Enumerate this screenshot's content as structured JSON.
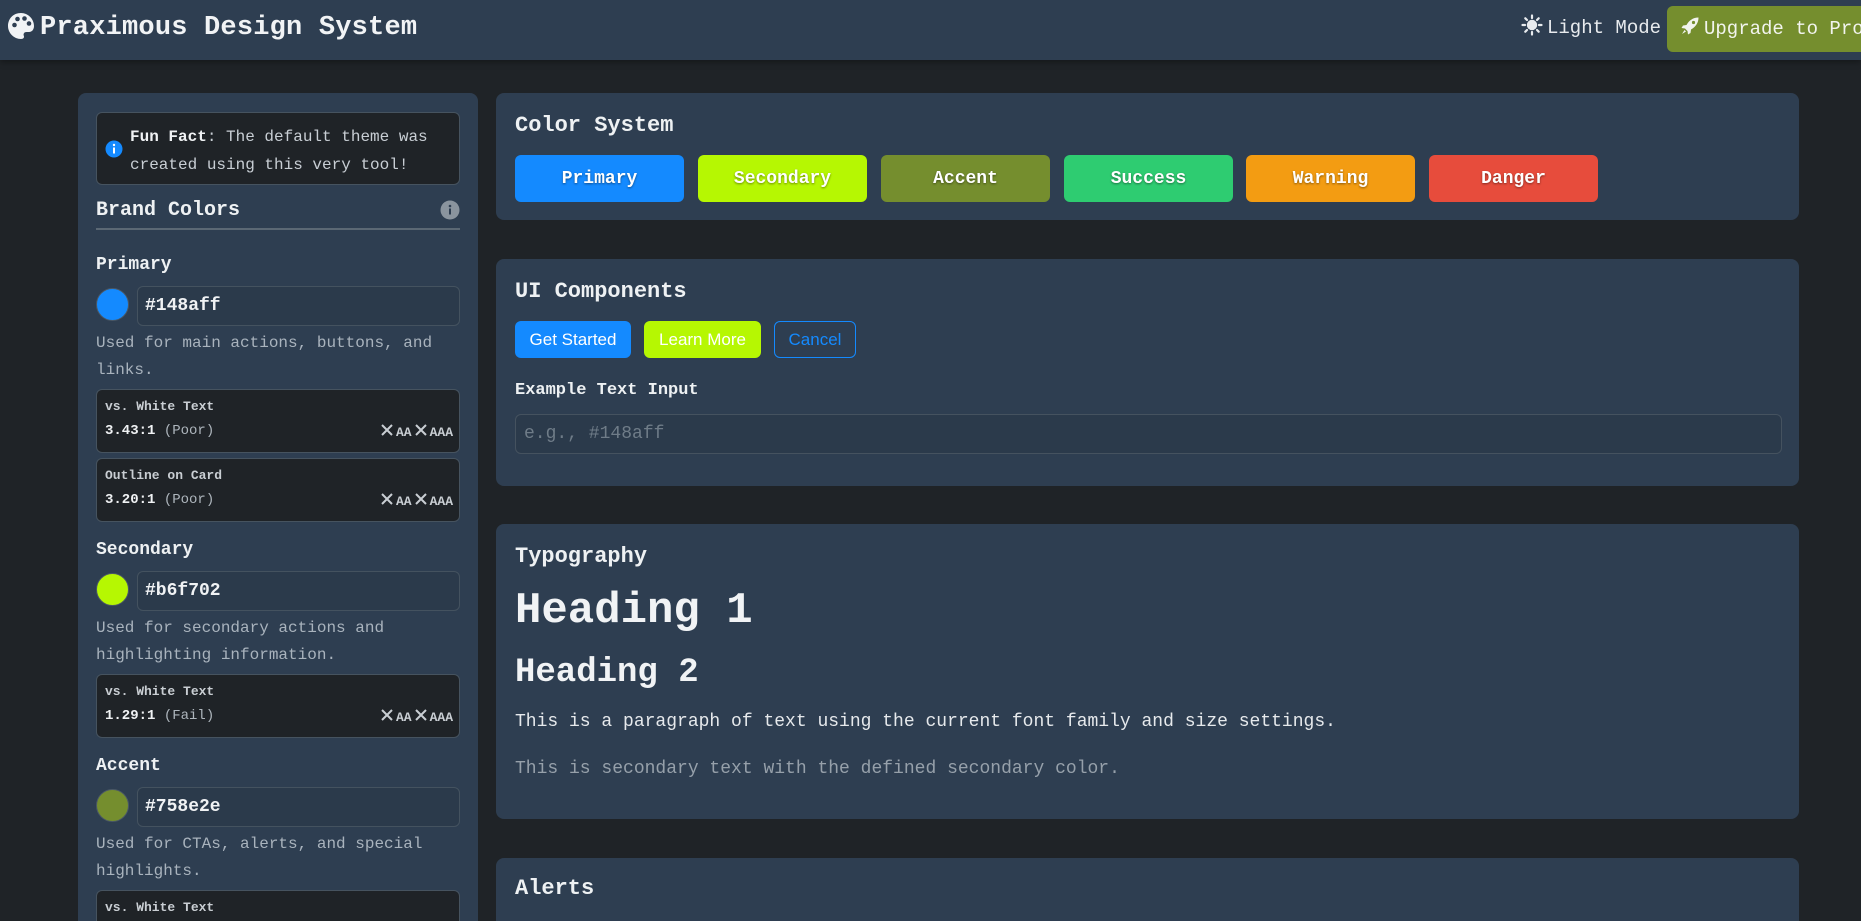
{
  "header": {
    "title": "Praximous Design System",
    "mode_toggle_label": "Light Mode",
    "upgrade_label": "Upgrade to Pro"
  },
  "sidebar": {
    "fun_fact": {
      "lead": "Fun Fact",
      "text": ": The default theme was created using this very tool!"
    },
    "section_title": "Brand Colors",
    "colors": [
      {
        "name": "Primary",
        "hex": "#148aff",
        "swatch": "#148aff",
        "description": "Used for main actions, buttons, and links.",
        "contrasts": [
          {
            "label": "vs. White Text",
            "ratio": "3.43:1",
            "rating": "(Poor)",
            "aa": "AA",
            "aaa": "AAA"
          },
          {
            "label": "Outline on Card",
            "ratio": "3.20:1",
            "rating": "(Poor)",
            "aa": "AA",
            "aaa": "AAA"
          }
        ]
      },
      {
        "name": "Secondary",
        "hex": "#b6f702",
        "swatch": "#b6f702",
        "description": "Used for secondary actions and highlighting information.",
        "contrasts": [
          {
            "label": "vs. White Text",
            "ratio": "1.29:1",
            "rating": "(Fail)",
            "aa": "AA",
            "aaa": "AAA"
          }
        ]
      },
      {
        "name": "Accent",
        "hex": "#758e2e",
        "swatch": "#758e2e",
        "description": "Used for CTAs, alerts, and special highlights.",
        "contrasts": [
          {
            "label": "vs. White Text"
          }
        ]
      }
    ]
  },
  "main": {
    "color_system": {
      "title": "Color System",
      "swatches": [
        {
          "label": "Primary",
          "color": "#148aff"
        },
        {
          "label": "Secondary",
          "color": "#b6f702"
        },
        {
          "label": "Accent",
          "color": "#758e2e"
        },
        {
          "label": "Success",
          "color": "#2ecc71"
        },
        {
          "label": "Warning",
          "color": "#f39c12"
        },
        {
          "label": "Danger",
          "color": "#e74c3c"
        }
      ]
    },
    "ui_components": {
      "title": "UI Components",
      "buttons": {
        "primary": "Get Started",
        "secondary": "Learn More",
        "outline": "Cancel"
      },
      "input_label": "Example Text Input",
      "input_placeholder": "e.g., #148aff"
    },
    "typography": {
      "title": "Typography",
      "h1": "Heading 1",
      "h2": "Heading 2",
      "paragraph": "This is a paragraph of text using the current font family and size settings.",
      "secondary_paragraph": "This is secondary text with the defined secondary color."
    },
    "alerts": {
      "title": "Alerts"
    }
  },
  "icons": {
    "brand": "palette-icon",
    "mode": "sun-icon",
    "upgrade": "rocket-icon",
    "info": "info-icon",
    "help": "info-circle-icon",
    "fail": "x-icon"
  }
}
